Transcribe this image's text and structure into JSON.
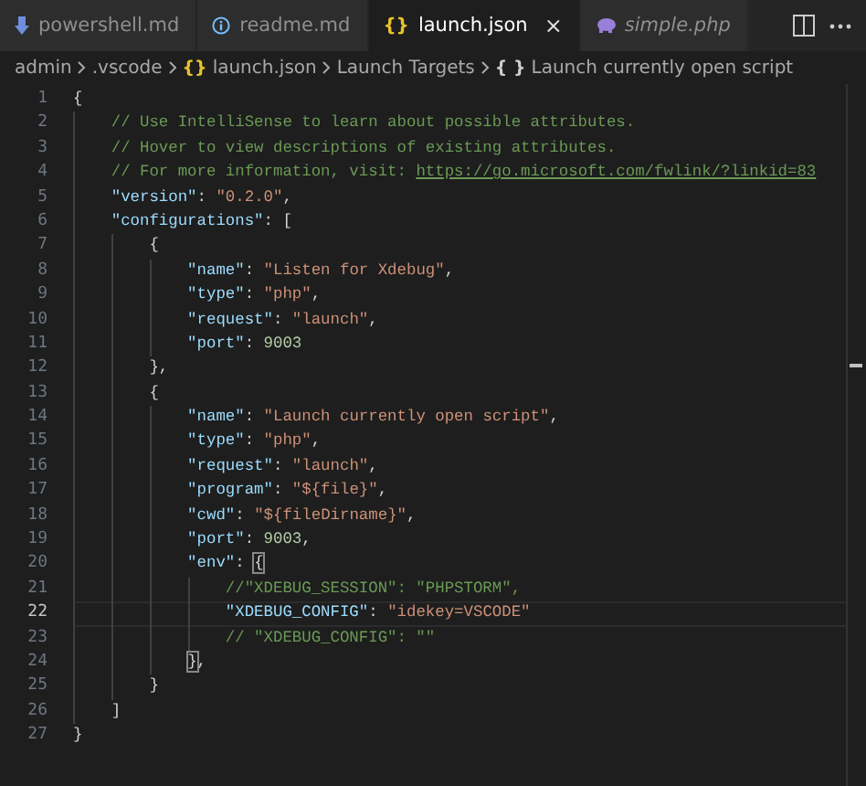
{
  "tabs": [
    {
      "label": "powershell.md",
      "kind": "markdown",
      "selected": false,
      "italic": false
    },
    {
      "label": "readme.md",
      "kind": "readme",
      "selected": false,
      "italic": false
    },
    {
      "label": "launch.json",
      "kind": "json",
      "glyph": "{}",
      "selected": true,
      "italic": false,
      "close": "×"
    },
    {
      "label": "simple.php",
      "kind": "php",
      "selected": false,
      "italic": true
    }
  ],
  "breadcrumb": [
    {
      "label": "admin"
    },
    {
      "label": ".vscode"
    },
    {
      "label": "launch.json",
      "glyph": "{}",
      "color": "#e8c22d"
    },
    {
      "label": "Launch Targets"
    },
    {
      "label": "Launch currently open script",
      "glyph": "{ }",
      "color": "#cccccc"
    }
  ],
  "editor": {
    "lines": [
      {
        "number": "1",
        "current": false,
        "tokens": [
          {
            "kind": "punct",
            "text": "{"
          }
        ]
      },
      {
        "number": "2",
        "current": false,
        "tokens": [
          {
            "kind": "comment",
            "text": "    // Use IntelliSense to learn about possible attributes."
          }
        ]
      },
      {
        "number": "3",
        "current": false,
        "tokens": [
          {
            "kind": "comment",
            "text": "    // Hover to view descriptions of existing attributes."
          }
        ]
      },
      {
        "number": "4",
        "current": false,
        "tokens": [
          {
            "kind": "comment",
            "text": "    // For more information, visit: "
          },
          {
            "kind": "link",
            "text": "https://go.microsoft.com/fwlink/?linkid=83"
          }
        ]
      },
      {
        "number": "5",
        "current": false,
        "tokens": [
          {
            "kind": "key",
            "text": "    \"version\""
          },
          {
            "kind": "punct",
            "text": ": "
          },
          {
            "kind": "string",
            "text": "\"0.2.0\""
          },
          {
            "kind": "punct",
            "text": ","
          }
        ]
      },
      {
        "number": "6",
        "current": false,
        "tokens": [
          {
            "kind": "key",
            "text": "    \"configurations\""
          },
          {
            "kind": "punct",
            "text": ": ["
          }
        ]
      },
      {
        "number": "7",
        "current": false,
        "tokens": [
          {
            "kind": "punct",
            "text": "        {"
          }
        ]
      },
      {
        "number": "8",
        "current": false,
        "tokens": [
          {
            "kind": "key",
            "text": "            \"name\""
          },
          {
            "kind": "punct",
            "text": ": "
          },
          {
            "kind": "string",
            "text": "\"Listen for Xdebug\""
          },
          {
            "kind": "punct",
            "text": ","
          }
        ]
      },
      {
        "number": "9",
        "current": false,
        "tokens": [
          {
            "kind": "key",
            "text": "            \"type\""
          },
          {
            "kind": "punct",
            "text": ": "
          },
          {
            "kind": "string",
            "text": "\"php\""
          },
          {
            "kind": "punct",
            "text": ","
          }
        ]
      },
      {
        "number": "10",
        "current": false,
        "tokens": [
          {
            "kind": "key",
            "text": "            \"request\""
          },
          {
            "kind": "punct",
            "text": ": "
          },
          {
            "kind": "string",
            "text": "\"launch\""
          },
          {
            "kind": "punct",
            "text": ","
          }
        ]
      },
      {
        "number": "11",
        "current": false,
        "tokens": [
          {
            "kind": "key",
            "text": "            \"port\""
          },
          {
            "kind": "punct",
            "text": ": "
          },
          {
            "kind": "number",
            "text": "9003"
          }
        ]
      },
      {
        "number": "12",
        "current": false,
        "tokens": [
          {
            "kind": "punct",
            "text": "        },"
          }
        ]
      },
      {
        "number": "13",
        "current": false,
        "tokens": [
          {
            "kind": "punct",
            "text": "        {"
          }
        ]
      },
      {
        "number": "14",
        "current": false,
        "tokens": [
          {
            "kind": "key",
            "text": "            \"name\""
          },
          {
            "kind": "punct",
            "text": ": "
          },
          {
            "kind": "string",
            "text": "\"Launch currently open script\""
          },
          {
            "kind": "punct",
            "text": ","
          }
        ]
      },
      {
        "number": "15",
        "current": false,
        "tokens": [
          {
            "kind": "key",
            "text": "            \"type\""
          },
          {
            "kind": "punct",
            "text": ": "
          },
          {
            "kind": "string",
            "text": "\"php\""
          },
          {
            "kind": "punct",
            "text": ","
          }
        ]
      },
      {
        "number": "16",
        "current": false,
        "tokens": [
          {
            "kind": "key",
            "text": "            \"request\""
          },
          {
            "kind": "punct",
            "text": ": "
          },
          {
            "kind": "string",
            "text": "\"launch\""
          },
          {
            "kind": "punct",
            "text": ","
          }
        ]
      },
      {
        "number": "17",
        "current": false,
        "tokens": [
          {
            "kind": "key",
            "text": "            \"program\""
          },
          {
            "kind": "punct",
            "text": ": "
          },
          {
            "kind": "string",
            "text": "\"${file}\""
          },
          {
            "kind": "punct",
            "text": ","
          }
        ]
      },
      {
        "number": "18",
        "current": false,
        "tokens": [
          {
            "kind": "key",
            "text": "            \"cwd\""
          },
          {
            "kind": "punct",
            "text": ": "
          },
          {
            "kind": "string",
            "text": "\"${fileDirname}\""
          },
          {
            "kind": "punct",
            "text": ","
          }
        ]
      },
      {
        "number": "19",
        "current": false,
        "tokens": [
          {
            "kind": "key",
            "text": "            \"port\""
          },
          {
            "kind": "punct",
            "text": ": "
          },
          {
            "kind": "number",
            "text": "9003"
          },
          {
            "kind": "punct",
            "text": ","
          }
        ]
      },
      {
        "number": "20",
        "current": false,
        "tokens": [
          {
            "kind": "key",
            "text": "            \"env\""
          },
          {
            "kind": "punct",
            "text": ": "
          },
          {
            "kind": "punct",
            "text": "{",
            "matched": true
          }
        ]
      },
      {
        "number": "21",
        "current": false,
        "tokens": [
          {
            "kind": "comment",
            "text": "                //\"XDEBUG_SESSION\": \"PHPSTORM\","
          }
        ]
      },
      {
        "number": "22",
        "current": true,
        "tokens": [
          {
            "kind": "key",
            "text": "                \"XDEBUG_CONFIG\""
          },
          {
            "kind": "punct",
            "text": ": "
          },
          {
            "kind": "string",
            "text": "\"idekey=VSCODE\""
          }
        ]
      },
      {
        "number": "23",
        "current": false,
        "tokens": [
          {
            "kind": "comment",
            "text": "                // \"XDEBUG_CONFIG\": \"\""
          }
        ]
      },
      {
        "number": "24",
        "current": false,
        "tokens": [
          {
            "kind": "punct",
            "text": "            }",
            "matched": true
          },
          {
            "kind": "punct",
            "text": ","
          }
        ]
      },
      {
        "number": "25",
        "current": false,
        "tokens": [
          {
            "kind": "punct",
            "text": "        }"
          }
        ]
      },
      {
        "number": "26",
        "current": false,
        "tokens": [
          {
            "kind": "punct",
            "text": "    ]"
          }
        ]
      },
      {
        "number": "27",
        "current": false,
        "tokens": [
          {
            "kind": "punct",
            "text": "}"
          }
        ]
      }
    ]
  }
}
